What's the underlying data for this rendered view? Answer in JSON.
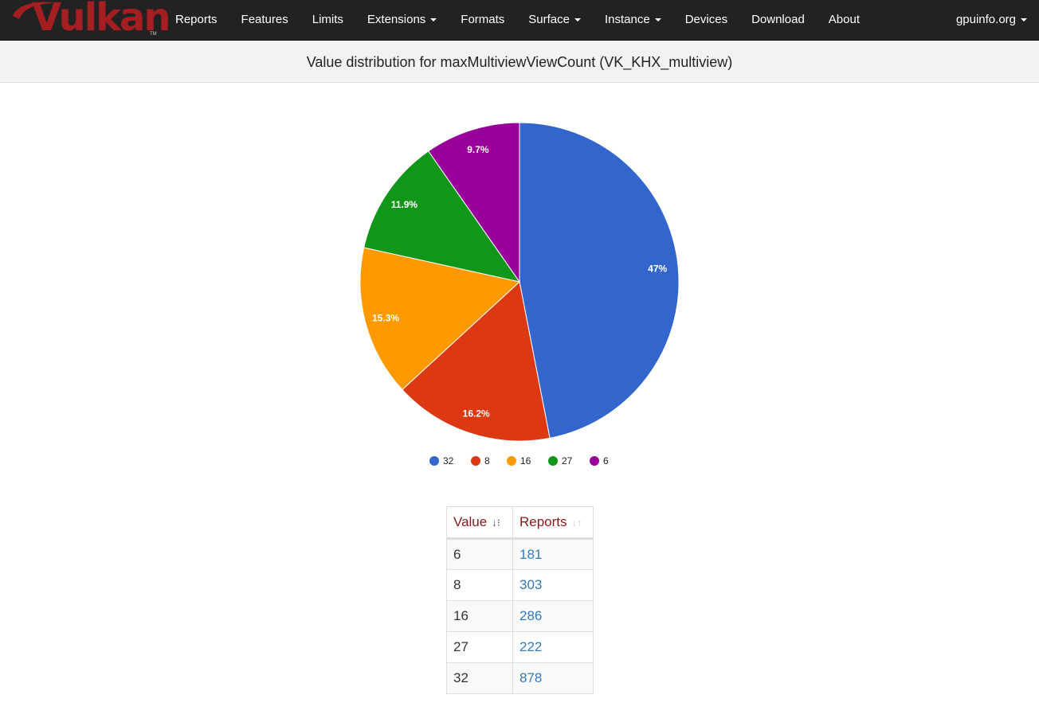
{
  "nav": {
    "items": [
      {
        "label": "Reports",
        "dropdown": false
      },
      {
        "label": "Features",
        "dropdown": false
      },
      {
        "label": "Limits",
        "dropdown": false
      },
      {
        "label": "Extensions",
        "dropdown": true
      },
      {
        "label": "Formats",
        "dropdown": false
      },
      {
        "label": "Surface",
        "dropdown": true
      },
      {
        "label": "Instance",
        "dropdown": true
      },
      {
        "label": "Devices",
        "dropdown": false
      },
      {
        "label": "Download",
        "dropdown": false
      },
      {
        "label": "About",
        "dropdown": false
      }
    ],
    "right_label": "gpuinfo.org",
    "brand": "Vulkan",
    "brand_tm": "TM"
  },
  "page": {
    "title": "Value distribution for maxMultiviewViewCount (VK_KHX_multiview)"
  },
  "chart_data": {
    "type": "pie",
    "categories": [
      "32",
      "8",
      "16",
      "27",
      "6"
    ],
    "values": [
      878,
      303,
      286,
      222,
      181
    ],
    "percent_labels": [
      "47%",
      "16.2%",
      "15.3%",
      "11.9%",
      "9.7%"
    ],
    "colors": [
      "#3366cc",
      "#dc3912",
      "#ff9900",
      "#109618",
      "#990099"
    ],
    "legend_position": "bottom"
  },
  "table": {
    "headers": {
      "value": "Value",
      "reports": "Reports"
    },
    "rows": [
      {
        "value": "6",
        "reports": "181"
      },
      {
        "value": "8",
        "reports": "303"
      },
      {
        "value": "16",
        "reports": "286"
      },
      {
        "value": "27",
        "reports": "222"
      },
      {
        "value": "32",
        "reports": "878"
      }
    ]
  }
}
